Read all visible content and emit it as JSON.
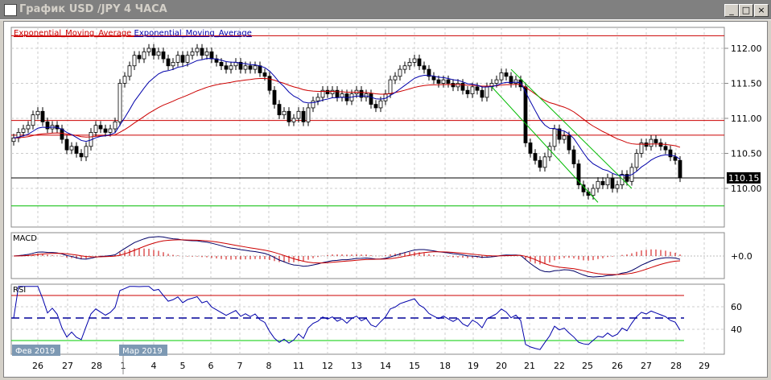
{
  "window": {
    "title": "График USD /JPY  4 ЧАСА",
    "min": "_",
    "max": "□",
    "close": "×"
  },
  "legend": {
    "ema1": "Exponential_Moving_Average",
    "ema2": "Exponential_Moving_Average",
    "ema1_color": "#cc0000",
    "ema2_color": "#0000aa"
  },
  "chart_data": {
    "type": "candlestick",
    "title": "USD/JPY 4H",
    "price_ticks": [
      "112.00",
      "111.50",
      "111.00",
      "110.50",
      "110.00"
    ],
    "price_tick_values": [
      112.0,
      111.5,
      111.0,
      110.5,
      110.0
    ],
    "ylim": [
      109.55,
      112.45
    ],
    "current_price": "110.15",
    "current_price_value": 110.15,
    "hlines_red": [
      112.18,
      110.97,
      110.76
    ],
    "hline_green": 109.75,
    "trendline": {
      "from": [
        99,
        111.45
      ],
      "to": [
        121,
        109.8
      ]
    },
    "trendline2": {
      "from": [
        103,
        111.7
      ],
      "to": [
        128,
        110.0
      ]
    },
    "closes": [
      110.72,
      110.8,
      110.85,
      110.9,
      111.05,
      111.1,
      110.95,
      110.85,
      110.9,
      110.85,
      110.7,
      110.55,
      110.6,
      110.5,
      110.45,
      110.6,
      110.8,
      110.9,
      110.85,
      110.8,
      110.85,
      110.95,
      111.5,
      111.6,
      111.75,
      111.9,
      111.85,
      111.95,
      112.0,
      111.9,
      111.95,
      111.85,
      111.75,
      111.8,
      111.9,
      111.8,
      111.9,
      111.95,
      112.0,
      111.9,
      111.95,
      111.85,
      111.8,
      111.75,
      111.7,
      111.75,
      111.8,
      111.7,
      111.75,
      111.7,
      111.75,
      111.65,
      111.6,
      111.4,
      111.2,
      111.05,
      111.1,
      110.95,
      111.0,
      111.1,
      110.95,
      111.15,
      111.25,
      111.3,
      111.4,
      111.35,
      111.4,
      111.3,
      111.35,
      111.25,
      111.35,
      111.4,
      111.3,
      111.35,
      111.2,
      111.15,
      111.25,
      111.35,
      111.55,
      111.6,
      111.7,
      111.75,
      111.8,
      111.85,
      111.75,
      111.7,
      111.6,
      111.55,
      111.5,
      111.55,
      111.5,
      111.45,
      111.5,
      111.4,
      111.35,
      111.45,
      111.4,
      111.3,
      111.45,
      111.5,
      111.55,
      111.65,
      111.6,
      111.5,
      111.55,
      111.45,
      110.65,
      110.5,
      110.4,
      110.3,
      110.45,
      110.6,
      110.85,
      110.7,
      110.75,
      110.55,
      110.35,
      110.05,
      109.95,
      109.9,
      110.0,
      110.1,
      110.05,
      110.15,
      110.0,
      110.05,
      110.2,
      110.1,
      110.3,
      110.5,
      110.65,
      110.6,
      110.7,
      110.65,
      110.6,
      110.55,
      110.45,
      110.4,
      110.15
    ],
    "ema_fast_period": 12,
    "ema_slow_period": 40,
    "macd": {
      "label": "MACD",
      "zero_label": "+0.0"
    },
    "rsi": {
      "label": "RSI",
      "ticks": [
        "60",
        "40"
      ],
      "tick_values": [
        60,
        40
      ],
      "levels": [
        70,
        50,
        30
      ],
      "ylim": [
        20,
        80
      ]
    },
    "x_labels": [
      "26",
      "27",
      "28",
      "1",
      "4",
      "5",
      "6",
      "7",
      "8",
      "11",
      "12",
      "13",
      "14",
      "15",
      "18",
      "19",
      "20",
      "21",
      "22",
      "25",
      "26",
      "27",
      "28",
      "29"
    ],
    "month_labels": [
      "Фев 2019",
      "Мар 2019"
    ]
  }
}
